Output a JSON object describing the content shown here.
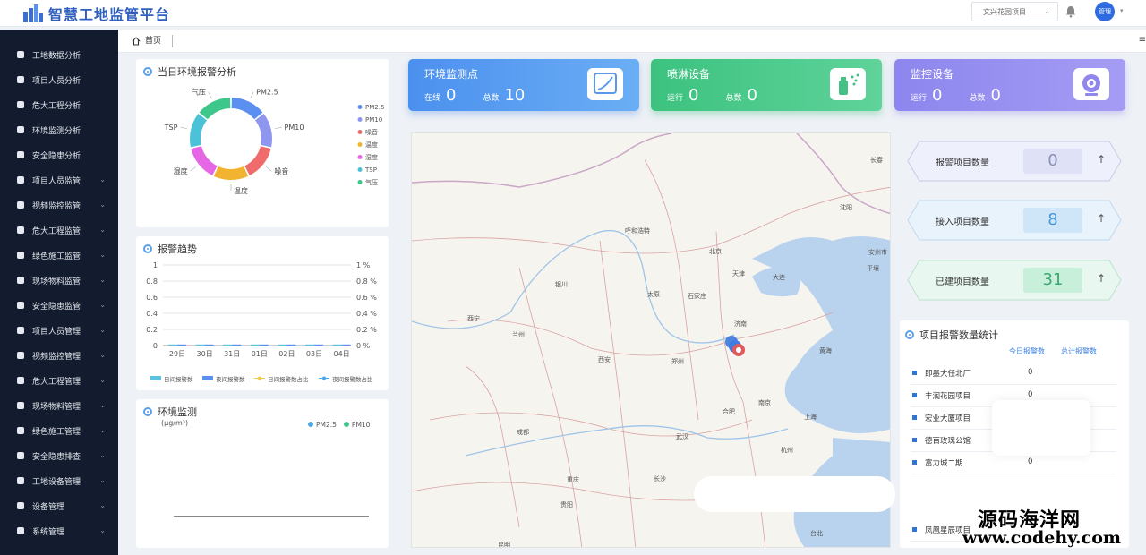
{
  "app": {
    "title": "智慧工地监管平台",
    "project_select": "文兴花园项目",
    "avatar_label": "管理"
  },
  "sidebar": {
    "items": [
      {
        "label": "工地数据分析",
        "icon": "document-icon",
        "has_sub": false
      },
      {
        "label": "项目人员分析",
        "icon": "user-icon",
        "has_sub": false
      },
      {
        "label": "危大工程分析",
        "icon": "filter-icon",
        "has_sub": false
      },
      {
        "label": "环境监测分析",
        "icon": "environment-icon",
        "has_sub": false
      },
      {
        "label": "安全隐患分析",
        "icon": "bar-chart-icon",
        "has_sub": false
      },
      {
        "label": "项目人员监管",
        "icon": "users-icon",
        "has_sub": true
      },
      {
        "label": "视频监控监管",
        "icon": "camera-icon",
        "has_sub": true
      },
      {
        "label": "危大工程监管",
        "icon": "stack-icon",
        "has_sub": true
      },
      {
        "label": "绿色施工监管",
        "icon": "shield-icon",
        "has_sub": true
      },
      {
        "label": "现场物料监管",
        "icon": "material-icon",
        "has_sub": true
      },
      {
        "label": "安全隐患监管",
        "icon": "clipboard-icon",
        "has_sub": true
      },
      {
        "label": "项目人员管理",
        "icon": "users-icon",
        "has_sub": true
      },
      {
        "label": "视频监控管理",
        "icon": "camera-icon",
        "has_sub": true
      },
      {
        "label": "危大工程管理",
        "icon": "document-icon",
        "has_sub": true
      },
      {
        "label": "现场物料管理",
        "icon": "circle-icon",
        "has_sub": true
      },
      {
        "label": "绿色施工管理",
        "icon": "user-icon",
        "has_sub": true
      },
      {
        "label": "安全隐患排查",
        "icon": "users-icon",
        "has_sub": true
      },
      {
        "label": "工地设备管理",
        "icon": "device-icon",
        "has_sub": true
      },
      {
        "label": "设备管理",
        "icon": "user-icon",
        "has_sub": true
      },
      {
        "label": "系统管理",
        "icon": "home-icon",
        "has_sub": true
      }
    ]
  },
  "tabs": {
    "home": "首页"
  },
  "env_alarm": {
    "title": "当日环境报警分析",
    "slices": [
      {
        "name": "PM2.5",
        "color": "#5b8ff0",
        "value": 1
      },
      {
        "name": "PM10",
        "color": "#8f96f0",
        "value": 1
      },
      {
        "name": "噪音",
        "color": "#f06b6b",
        "value": 1
      },
      {
        "name": "温度",
        "color": "#f2b330",
        "value": 1
      },
      {
        "name": "湿度",
        "color": "#e667e6",
        "value": 1
      },
      {
        "name": "TSP",
        "color": "#4bc2d8",
        "value": 1
      },
      {
        "name": "气压",
        "color": "#3ec78a",
        "value": 1
      }
    ]
  },
  "alarm_trend": {
    "title": "报警趋势",
    "left_ticks": [
      "1",
      "0.8",
      "0.6",
      "0.4",
      "0.2",
      "0"
    ],
    "right_ticks": [
      "1 %",
      "0.8 %",
      "0.6 %",
      "0.4 %",
      "0.2 %",
      "0 %"
    ],
    "x_labels": [
      "29日",
      "30日",
      "31日",
      "01日",
      "02日",
      "03日",
      "04日"
    ],
    "legend": [
      "日间报警数",
      "夜间报警数",
      "日间报警数占比",
      "夜间报警数占比"
    ]
  },
  "chart_data": {
    "type": "bar",
    "categories": [
      "29日",
      "30日",
      "31日",
      "01日",
      "02日",
      "03日",
      "04日"
    ],
    "series": [
      {
        "name": "日间报警数",
        "values": [
          0,
          0,
          0,
          0,
          0,
          0,
          0
        ]
      },
      {
        "name": "夜间报警数",
        "values": [
          0,
          0,
          0,
          0,
          0,
          0,
          0
        ]
      },
      {
        "name": "日间报警数占比",
        "values": [
          0,
          0,
          0,
          0,
          0,
          0,
          0
        ]
      },
      {
        "name": "夜间报警数占比",
        "values": [
          0,
          0,
          0,
          0,
          0,
          0,
          0
        ]
      }
    ],
    "ylim": [
      0,
      1
    ]
  },
  "env_monitor": {
    "title": "环境监测",
    "unit": "(μg/m³)",
    "legend": [
      "PM2.5",
      "PM10"
    ]
  },
  "stats": [
    {
      "title": "环境监测点",
      "k1": "在线",
      "v1": "0",
      "k2": "总数",
      "v2": "10",
      "icon": "chart-icon"
    },
    {
      "title": "喷淋设备",
      "k1": "运行",
      "v1": "0",
      "k2": "总数",
      "v2": "0",
      "icon": "sprinkler-icon"
    },
    {
      "title": "监控设备",
      "k1": "运行",
      "v1": "0",
      "k2": "总数",
      "v2": "0",
      "icon": "webcam-icon"
    }
  ],
  "map_labels": [
    "长春",
    "沈阳",
    "呼和浩特",
    "北京",
    "天津",
    "大连",
    "安州市",
    "平壤",
    "银川",
    "太原",
    "石家庄",
    "西宁",
    "兰州",
    "济南",
    "西安",
    "郑州",
    "黄海",
    "南京",
    "合肥",
    "上海",
    "成都",
    "重庆",
    "武汉",
    "杭州",
    "长沙",
    "贵阳",
    "昆明",
    "台北"
  ],
  "counters": [
    {
      "label": "报警项目数量",
      "value": "0"
    },
    {
      "label": "接入项目数量",
      "value": "8"
    },
    {
      "label": "已建项目数量",
      "value": "31"
    }
  ],
  "alarm_projects": {
    "title": "项目报警数量统计",
    "tab_today": "今日报警数",
    "tab_total": "总计报警数",
    "rows": [
      {
        "name": "即墨大任北厂",
        "value": "0"
      },
      {
        "name": "丰润花园项目",
        "value": "0"
      },
      {
        "name": "宏业大厦项目",
        "value": ""
      },
      {
        "name": "德百玫瑰公馆",
        "value": ""
      },
      {
        "name": "富力城二期",
        "value": "0"
      },
      {
        "name": "凤凰星辰项目",
        "value": ""
      }
    ]
  },
  "watermark": {
    "cn": "源码海洋网",
    "url": "www.codehy.com"
  }
}
